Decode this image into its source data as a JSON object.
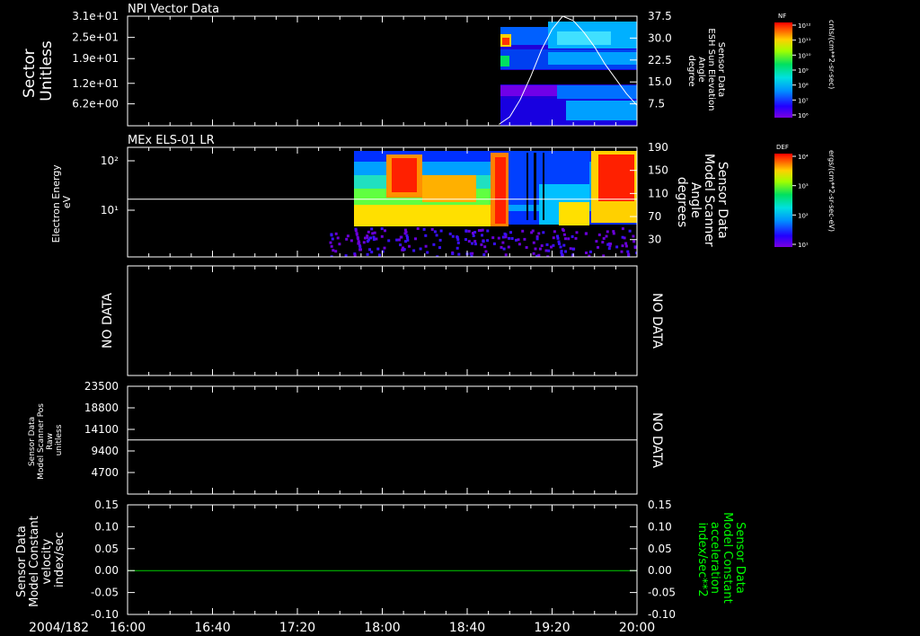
{
  "time_axis": {
    "date_label": "2004/182",
    "tick_labels": [
      "16:00",
      "16:40",
      "17:20",
      "18:00",
      "18:40",
      "19:20",
      "20:00"
    ],
    "range": [
      "16:00",
      "20:00"
    ]
  },
  "colors": {
    "frame": "#ffffff",
    "background": "#000000",
    "green_line": "#00d000",
    "right_label_green": "#00ff00"
  },
  "chart_data": [
    {
      "type": "heatmap",
      "title": "NPI Vector Data",
      "ylabel": "Sector\nUnitless",
      "y_ticks": [
        "3.1e+01",
        "2.5e+01",
        "1.9e+01",
        "1.2e+01",
        "6.2e+00"
      ],
      "ylim": [
        0,
        31
      ],
      "right_axis": {
        "label": "Sensor Data\nESH Sun Elevation\nAngle\ndegree",
        "ticks": [
          "37.5",
          "30.0",
          "22.5",
          "15.0",
          "7.5"
        ],
        "ylim": [
          0,
          37.5
        ]
      },
      "data_start": "18:55",
      "overlay_line": {
        "x": [
          "18:55",
          "19:00",
          "19:05",
          "19:10",
          "19:15",
          "19:20",
          "19:25",
          "19:30",
          "19:35",
          "19:40",
          "19:45",
          "19:50",
          "19:55",
          "20:00"
        ],
        "y": [
          0.5,
          3,
          9,
          17,
          26,
          33,
          37.5,
          36,
          32,
          27,
          21,
          16,
          11,
          7
        ]
      },
      "colorbar": {
        "label": "NF",
        "units": "cnts/(cm**2-sr-sec)",
        "tick_labels": [
          "10¹²",
          "10¹¹",
          "10¹⁰",
          "10⁹",
          "10⁸",
          "10⁷",
          "10⁶"
        ]
      }
    },
    {
      "type": "heatmap",
      "title": "MEx ELS-01 LR",
      "ylabel": "Electron Energy\neV",
      "y_ticks": [
        "10²",
        "10¹"
      ],
      "yscale": "log",
      "right_axis": {
        "label": "Sensor Data\nModel Scanner\nAngle\ndegrees",
        "ticks": [
          "190",
          "150",
          "110",
          "70",
          "30"
        ],
        "ylim": [
          0,
          190
        ]
      },
      "data_start": "17:35",
      "overlay_line": {
        "y": 100
      },
      "colorbar": {
        "label": "DEF",
        "units": "ergs/(cm**2-sr-sec-eV)",
        "tick_labels": [
          "10⁴",
          "10³",
          "10²",
          "10¹"
        ]
      }
    },
    {
      "type": "line",
      "left_label": "NO DATA",
      "right_label": "NO DATA"
    },
    {
      "type": "line",
      "ylabel": "Sensor Data\nModel Scanner Pos\nRaw\nunitless",
      "y_ticks": [
        "23500",
        "18800",
        "14100",
        "9400",
        "4700"
      ],
      "ylim": [
        0,
        23500
      ],
      "right_label": "NO DATA",
      "series": [
        {
          "x": [
            "16:00",
            "20:00"
          ],
          "y": [
            11800,
            11800
          ]
        }
      ]
    },
    {
      "type": "line",
      "ylabel": "Sensor Data\nModel Constant\nvelocity\nindex/sec",
      "y_ticks": [
        "0.15",
        "0.10",
        "0.05",
        "0.00",
        "-0.05",
        "-0.10"
      ],
      "ylim": [
        -0.1,
        0.15
      ],
      "right_axis": {
        "label": "Sensor Data\nModel Constant\nacceleration\nindex/sec**2",
        "ticks": [
          "0.15",
          "0.10",
          "0.05",
          "0.00",
          "-0.05",
          "-0.10"
        ]
      },
      "series": [
        {
          "x": [
            "16:00",
            "20:00"
          ],
          "y": [
            0,
            0
          ]
        }
      ]
    }
  ]
}
